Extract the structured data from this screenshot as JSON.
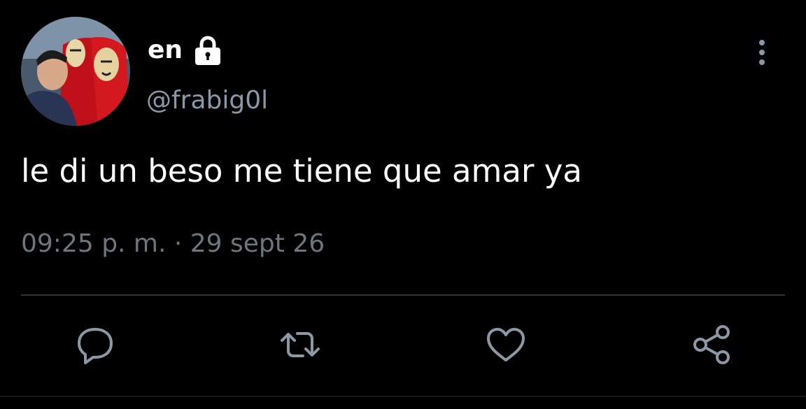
{
  "tweet": {
    "display_name": "en",
    "handle": "@frabig0l",
    "text": "le di un beso me tiene que amar ya",
    "timestamp": "09:25 p. m. · 29 sept 26",
    "protected_icon": "lock-icon",
    "menu_icon": "more-vertical-icon"
  },
  "actions": {
    "reply_icon": "comment-icon",
    "retweet_icon": "retweet-icon",
    "like_icon": "heart-icon",
    "share_icon": "share-icon"
  },
  "colors": {
    "background": "#000000",
    "primary_text": "#ffffff",
    "secondary_text": "#8b98a5",
    "timestamp_text": "#6e767d",
    "icon": "#8b98a5",
    "divider": "#2f3336"
  }
}
